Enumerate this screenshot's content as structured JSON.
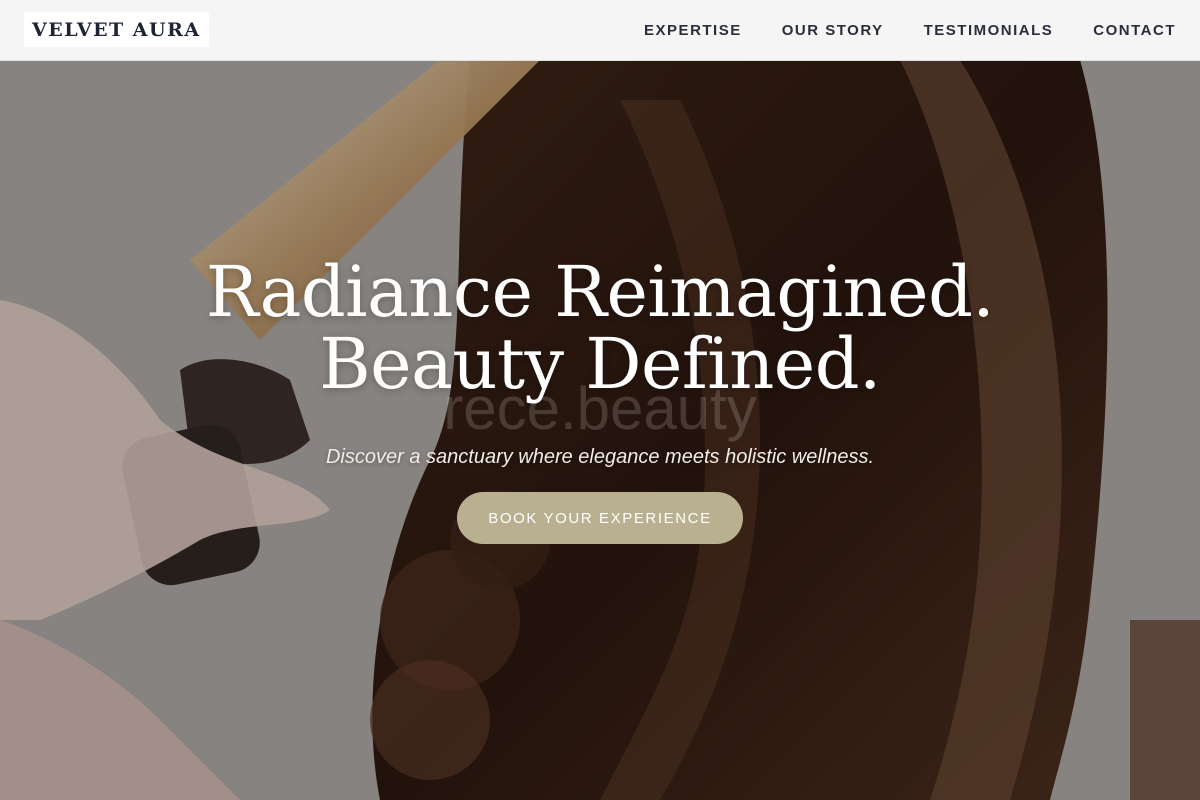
{
  "header": {
    "logo_text": "VELVET AURA",
    "nav": [
      {
        "label": "EXPERTISE"
      },
      {
        "label": "OUR STORY"
      },
      {
        "label": "TESTIMONIALS"
      },
      {
        "label": "CONTACT"
      }
    ]
  },
  "hero": {
    "title_line1": "Radiance Reimagined.",
    "title_line2": "Beauty Defined.",
    "watermark": "rece.beauty",
    "subtitle": "Discover a sanctuary where elegance meets holistic wellness.",
    "cta_label": "BOOK YOUR EXPERIENCE",
    "image_description": "stylist curling long brunette hair with a curling iron"
  },
  "colors": {
    "header_bg": "#fafafa",
    "nav_text": "#2a2e3a",
    "cta_bg": "#b9b08f",
    "title_text": "#ffffff"
  }
}
